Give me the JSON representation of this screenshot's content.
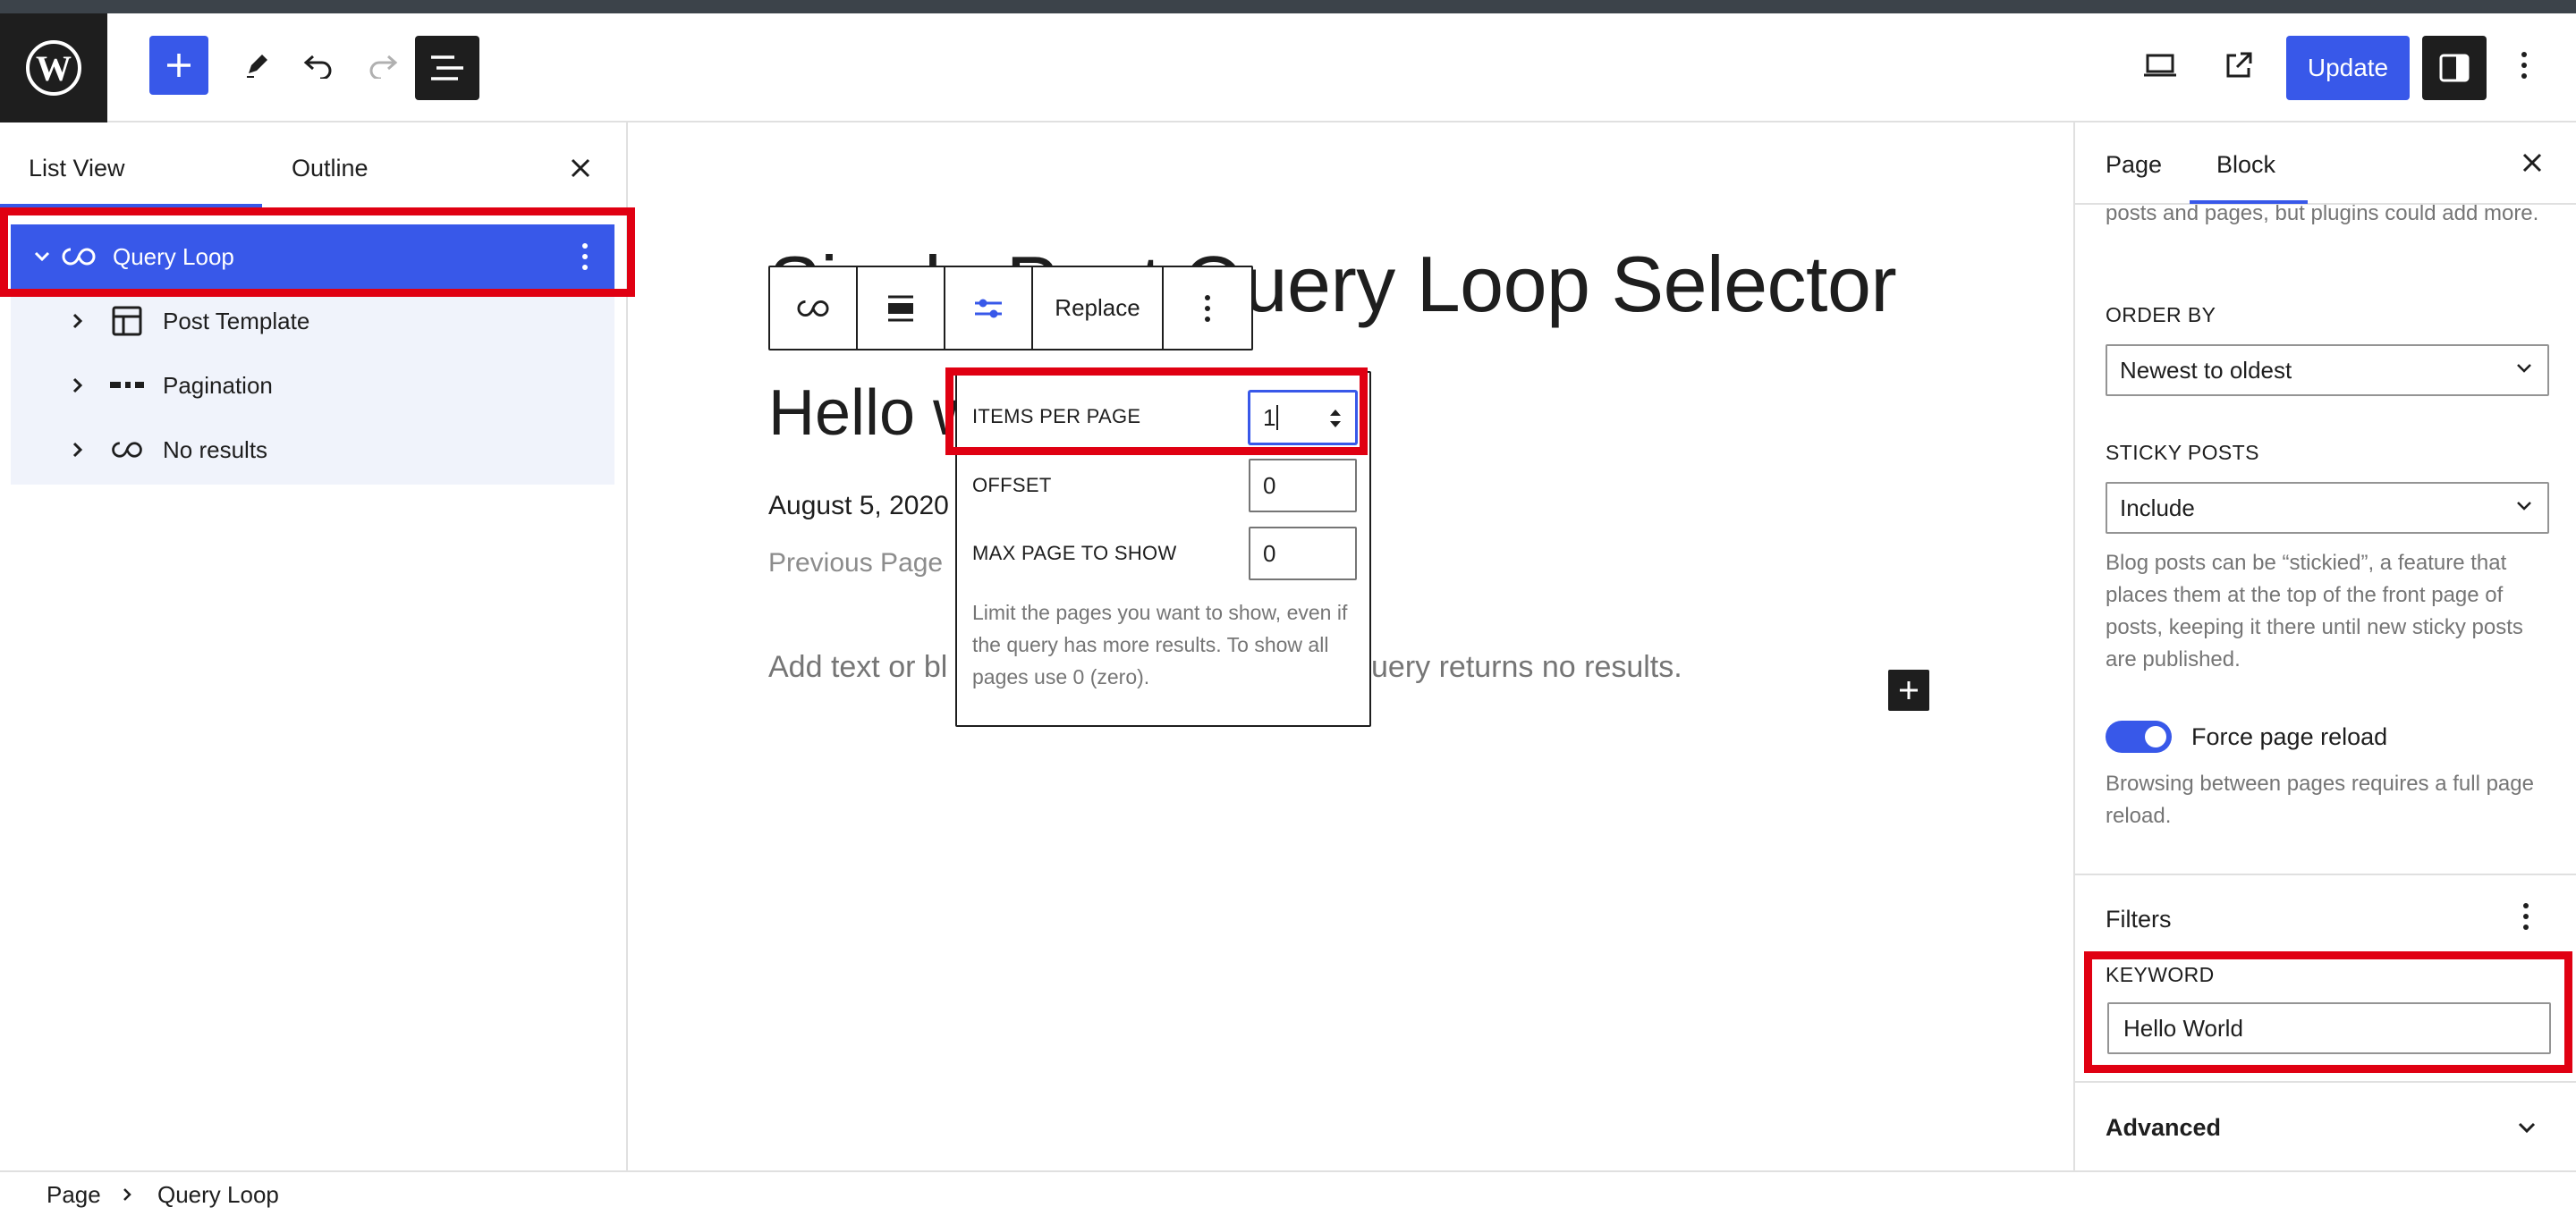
{
  "toolbar": {
    "update_label": "Update"
  },
  "list_view": {
    "tabs": [
      "List View",
      "Outline"
    ],
    "items": [
      {
        "label": "Query Loop",
        "icon": "loop-icon"
      },
      {
        "label": "Post Template",
        "icon": "layout-icon"
      },
      {
        "label": "Pagination",
        "icon": "pagination-icon"
      },
      {
        "label": "No results",
        "icon": "loop-icon"
      }
    ]
  },
  "canvas": {
    "page_title": "Single Post Query Loop Selector",
    "post_title": "Hello w",
    "post_date": "August 5, 2020",
    "previous_page": "Previous Page",
    "no_results_left": "Add text or bl",
    "no_results_right": "uery returns no results."
  },
  "block_toolbar": {
    "replace_label": "Replace"
  },
  "popover": {
    "items_per_page_label": "ITEMS PER PAGE",
    "items_per_page_value": "1",
    "offset_label": "OFFSET",
    "offset_value": "0",
    "max_page_label": "MAX PAGE TO SHOW",
    "max_page_value": "0",
    "help": "Limit the pages you want to show, even if the query has more results. To show all pages use 0 (zero)."
  },
  "sidebar": {
    "tabs": [
      "Page",
      "Block"
    ],
    "top_help": "posts and pages, but plugins could add more.",
    "order_by_label": "ORDER BY",
    "order_by_value": "Newest to oldest",
    "sticky_label": "STICKY POSTS",
    "sticky_value": "Include",
    "sticky_help": "Blog posts can be “stickied”, a feature that places them at the top of the front page of posts, keeping it there until new sticky posts are published.",
    "force_reload_label": "Force page reload",
    "force_reload_help": "Browsing between pages requires a full page reload.",
    "filters_label": "Filters",
    "keyword_label": "KEYWORD",
    "keyword_value": "Hello World",
    "advanced_label": "Advanced"
  },
  "footer": {
    "crumbs": [
      "Page",
      "Query Loop"
    ]
  },
  "colors": {
    "accent": "#3858e9",
    "highlight": "#e00012",
    "dark": "#1e1e1e"
  }
}
